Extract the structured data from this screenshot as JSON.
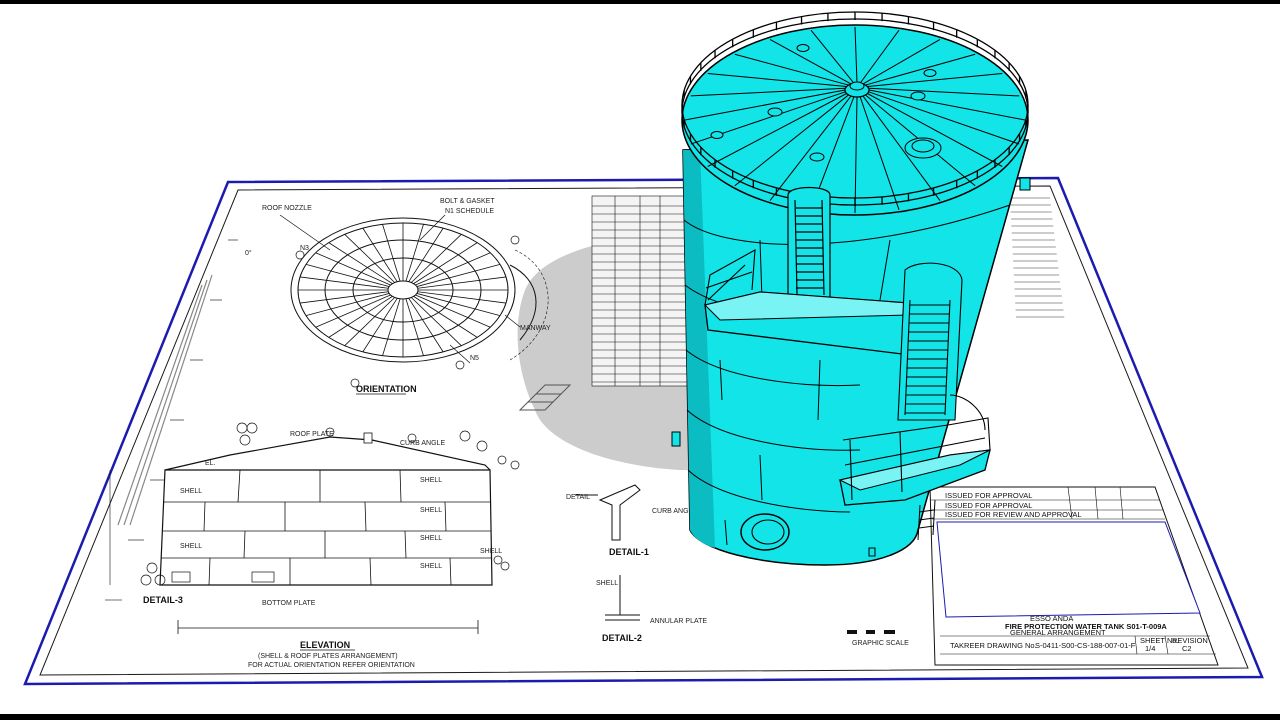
{
  "drawing": {
    "orientation_label": "ORIENTATION",
    "elevation_label": "ELEVATION",
    "elevation_note_1": "(SHELL & ROOF PLATES ARRANGEMENT)",
    "elevation_note_2": "FOR ACTUAL ORIENTATION REFER ORIENTATION",
    "detail_1": "DETAIL-1",
    "detail_2": "DETAIL-2",
    "detail_3": "DETAIL-3",
    "graphic_scale": "GRAPHIC SCALE",
    "title_block": {
      "project": "ESSO ANDA",
      "title_line_1": "FIRE PROTECTION WATER TANK S01-T-009A",
      "title_line_2": "GENERAL ARRANGEMENT",
      "drawing_no_label": "TAKREER DRAWING No.",
      "drawing_no": "S-0411-S00-CS-188-007-01-F",
      "sheet_label": "SHEET No.",
      "sheet_value": "1/4",
      "revision_label": "REVISION",
      "revision_value": "C2",
      "rev_rows": [
        "ISSUED FOR APPROVAL",
        "ISSUED FOR APPROVAL",
        "ISSUED FOR REVIEW AND APPROVAL"
      ]
    },
    "colors": {
      "sheet_border": "#1b1bb0",
      "tank_fill": "#12e4e8",
      "tank_shade": "#0bbcc3",
      "shadow": "#c9c9c9",
      "line": "#000000"
    }
  },
  "tank": {
    "icon": "storage-tank-3d-model"
  }
}
